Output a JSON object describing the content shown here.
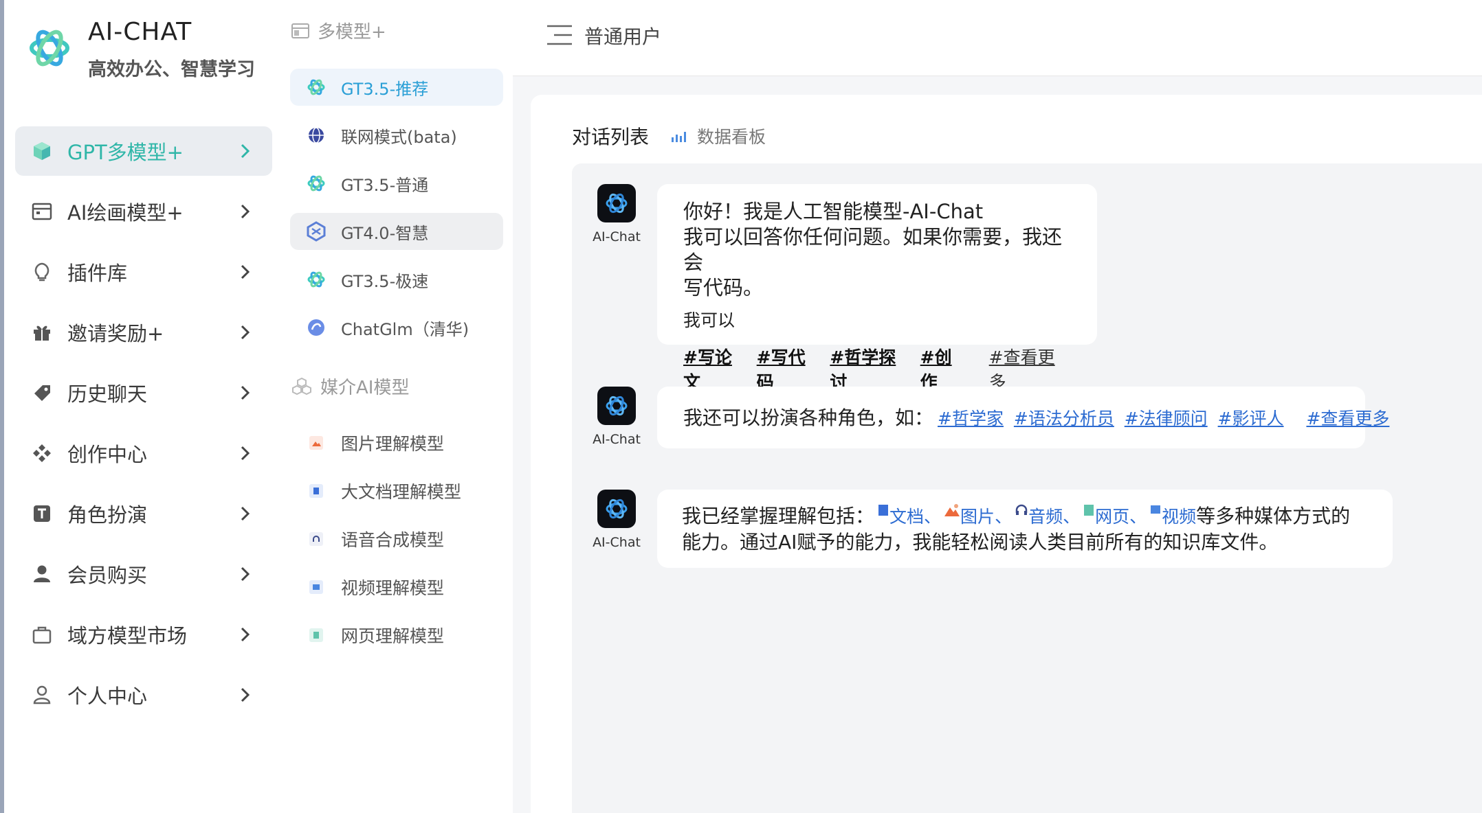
{
  "brand": {
    "title": "AI-CHAT",
    "subtitle": "高效办公、智慧学习"
  },
  "sidebar": {
    "items": [
      {
        "label": "GPT多模型+",
        "icon": "cube-icon",
        "active": true
      },
      {
        "label": "AI绘画模型+",
        "icon": "calendar-icon"
      },
      {
        "label": "插件库",
        "icon": "bulb-icon"
      },
      {
        "label": "邀请奖励+",
        "icon": "gift-icon"
      },
      {
        "label": "历史聊天",
        "icon": "tag-icon"
      },
      {
        "label": "创作中心",
        "icon": "diamond-grid-icon"
      },
      {
        "label": "角色扮演",
        "icon": "text-box-icon"
      },
      {
        "label": "会员购买",
        "icon": "user-solid-icon"
      },
      {
        "label": "域方模型市场",
        "icon": "bag-icon"
      },
      {
        "label": "个人中心",
        "icon": "user-outline-icon"
      }
    ]
  },
  "models": {
    "header": "多模型+",
    "items": [
      {
        "label": "GT3.5-推荐",
        "icon": "openai-icon"
      },
      {
        "label": "联网模式(bata)",
        "icon": "globe-icon"
      },
      {
        "label": "GT3.5-普通",
        "icon": "openai-icon"
      },
      {
        "label": "GT4.0-智慧",
        "icon": "hexagon-icon"
      },
      {
        "label": "GT3.5-极速",
        "icon": "openai-icon"
      },
      {
        "label": "ChatGlm（清华)",
        "icon": "chatglm-icon"
      }
    ]
  },
  "media": {
    "header": "媒介AI模型",
    "items": [
      {
        "label": "图片理解模型",
        "icon": "image-icon"
      },
      {
        "label": "大文档理解模型",
        "icon": "document-icon"
      },
      {
        "label": "语音合成模型",
        "icon": "audio-icon"
      },
      {
        "label": "视频理解模型",
        "icon": "video-icon"
      },
      {
        "label": "网页理解模型",
        "icon": "webpage-icon"
      }
    ]
  },
  "topbar": {
    "user_role": "普通用户"
  },
  "tabs": {
    "chat_list": "对话列表",
    "dashboard": "数据看板"
  },
  "chat": {
    "bot_name": "AI-Chat",
    "msg1": {
      "line1": "你好！我是人工智能模型-AI-Chat",
      "line2": "我可以回答你任何问题。如果你需要，我还会",
      "line3": "写代码。",
      "line4": "我可以",
      "tags": [
        "#写论文",
        "#写代码",
        "#哲学探讨",
        "#创作"
      ],
      "more": "#查看更多"
    },
    "msg2": {
      "text": "我还可以扮演各种角色，如：",
      "tags": [
        "#哲学家",
        "#语法分析员",
        "#法律顾问",
        "#影评人"
      ],
      "more": "#查看更多"
    },
    "msg3": {
      "prefix": "我已经掌握理解包括：",
      "types": [
        "文档",
        "图片",
        "音频",
        "网页",
        "视频"
      ],
      "sep1": "、",
      "sep2": "、",
      "sep3": "、",
      "sep4": "、",
      "suffix": "等多种媒体方式的",
      "line2": "能力。通过AI赋予的能力，我能轻松阅读人类目前所有的知识库文件。"
    }
  },
  "colors": {
    "accent": "#2fb6a8",
    "link": "#2c6bd1",
    "selected_model": "#2a9fd6"
  }
}
